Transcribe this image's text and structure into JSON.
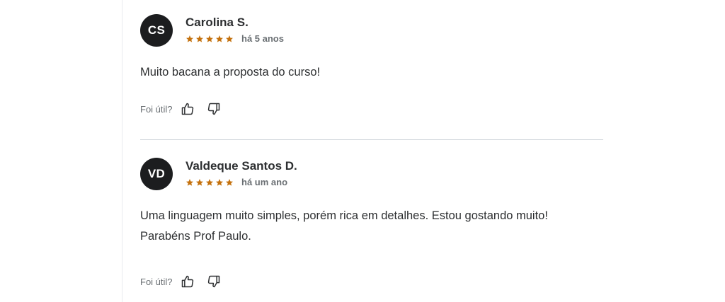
{
  "reviews": [
    {
      "initials": "CS",
      "name": "Carolina S.",
      "rating": 5,
      "time": "há 5 anos",
      "content_lines": [
        "Muito bacana a proposta do curso!"
      ],
      "helpful_label": "Foi útil?"
    },
    {
      "initials": "VD",
      "name": "Valdeque Santos D.",
      "rating": 5,
      "time": "há um ano",
      "content_lines": [
        "Uma linguagem muito simples, porém rica em detalhes. Estou gostando muito!",
        "Parabéns Prof Paulo."
      ],
      "helpful_label": "Foi útil?"
    }
  ],
  "icons": {
    "star": "star-icon",
    "like": "thumbs-up-icon",
    "dislike": "thumbs-down-icon"
  },
  "colors": {
    "avatar_bg": "#1c1d1f",
    "star": "#c4710d",
    "text": "#2d2f31",
    "muted": "#6a6f73"
  }
}
